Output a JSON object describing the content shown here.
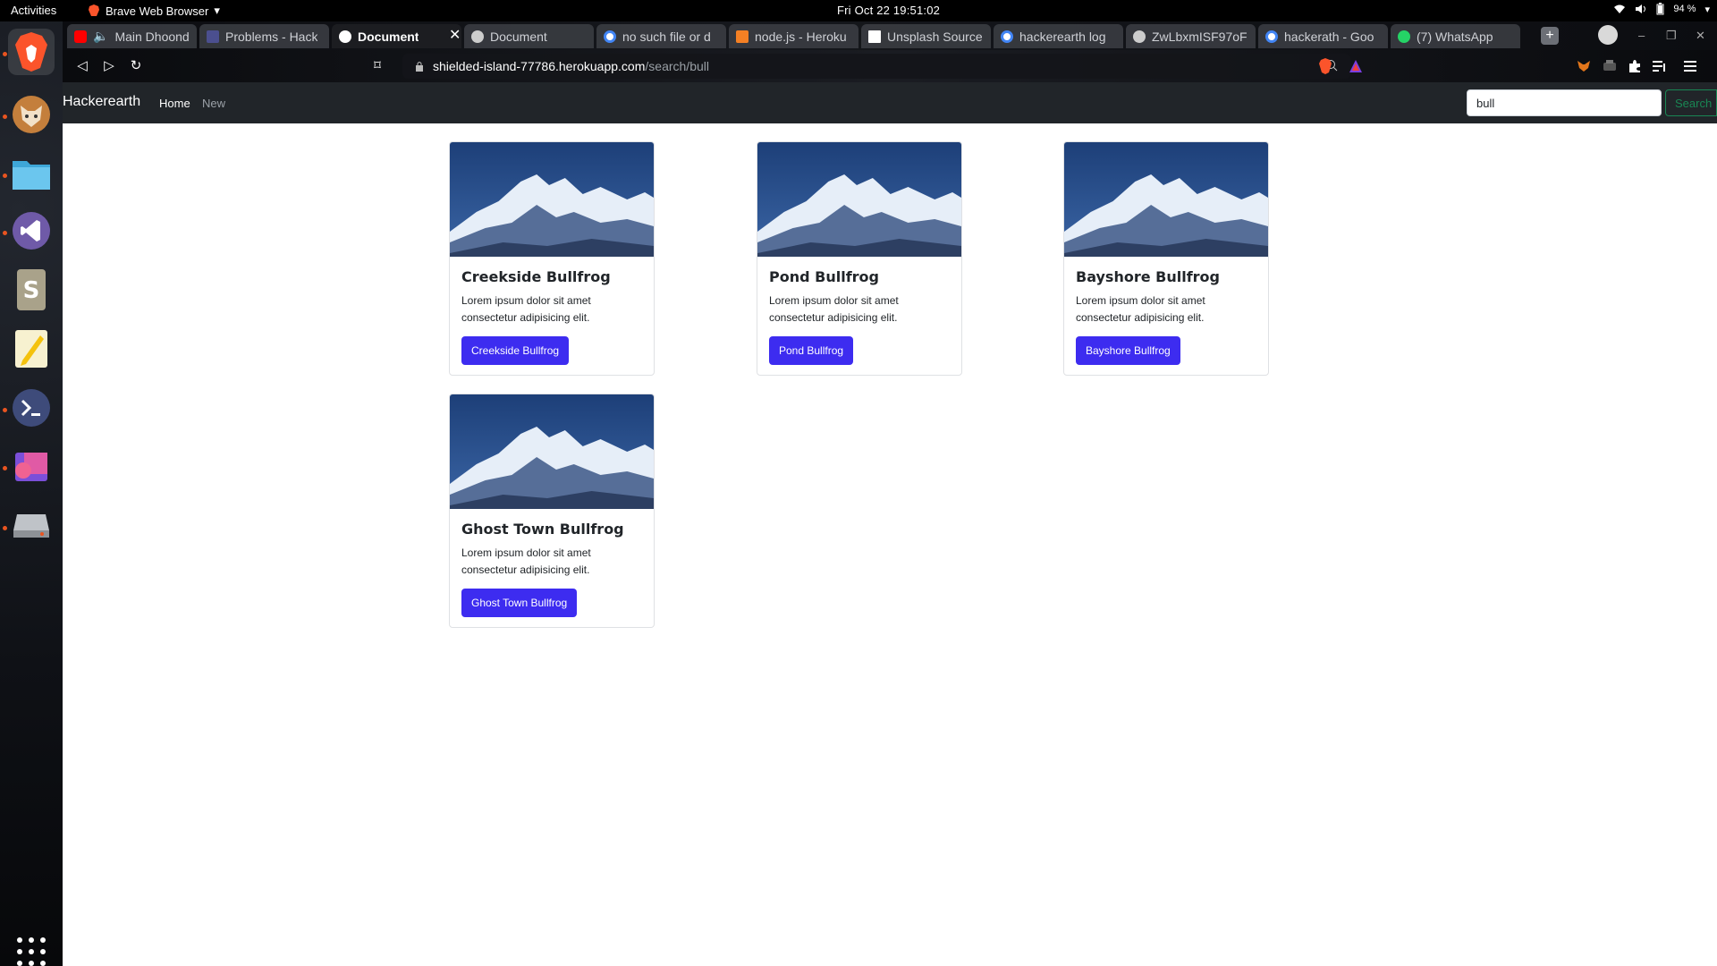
{
  "system_bar": {
    "activities": "Activities",
    "app_name": "Brave Web Browser",
    "clock": "Fri Oct 22  19:51:02",
    "battery": "94 %"
  },
  "browser": {
    "tabs": [
      {
        "label": "Main Dhoond",
        "fav_color": "#ff0000"
      },
      {
        "label": "Problems - Hack",
        "fav_color": "#4b4f8f"
      },
      {
        "label": "Document",
        "fav_color": "#ffffff",
        "active": true
      },
      {
        "label": "Document",
        "fav_color": "#cccccc"
      },
      {
        "label": "no such file or d",
        "fav_color": "#4285f4"
      },
      {
        "label": "node.js - Heroku",
        "fav_color": "#f48024"
      },
      {
        "label": "Unsplash Source",
        "fav_color": "#111111"
      },
      {
        "label": "hackerearth log",
        "fav_color": "#4285f4"
      },
      {
        "label": "ZwLbxmISF97oF",
        "fav_color": "#cccccc"
      },
      {
        "label": "hackerath - Goo",
        "fav_color": "#4285f4"
      },
      {
        "label": "(7) WhatsApp",
        "fav_color": "#25d366"
      }
    ],
    "url_host": "shielded-island-77786.herokuapp.com",
    "url_path": "/search/bull"
  },
  "site": {
    "brand": "Hackerearth",
    "nav_home": "Home",
    "nav_new": "New",
    "search_value": "bull",
    "search_button": "Search"
  },
  "cards": [
    {
      "title": "Creekside Bullfrog",
      "text": "Lorem ipsum dolor sit amet consectetur adipisicing elit.",
      "button": "Creekside Bullfrog"
    },
    {
      "title": "Pond Bullfrog",
      "text": "Lorem ipsum dolor sit amet consectetur adipisicing elit.",
      "button": "Pond Bullfrog"
    },
    {
      "title": "Bayshore Bullfrog",
      "text": "Lorem ipsum dolor sit amet consectetur adipisicing elit.",
      "button": "Bayshore Bullfrog"
    },
    {
      "title": "Ghost Town Bullfrog",
      "text": "Lorem ipsum dolor sit amet consectetur adipisicing elit.",
      "button": "Ghost Town Bullfrog"
    }
  ],
  "dock": [
    "brave-browser-icon",
    "gitlab-fox-icon",
    "files-folder-icon",
    "vscode-icon",
    "sublime-text-icon",
    "text-editor-icon",
    "terminal-icon",
    "screenshot-app-icon",
    "disk-drive-icon",
    "show-applications-icon"
  ]
}
